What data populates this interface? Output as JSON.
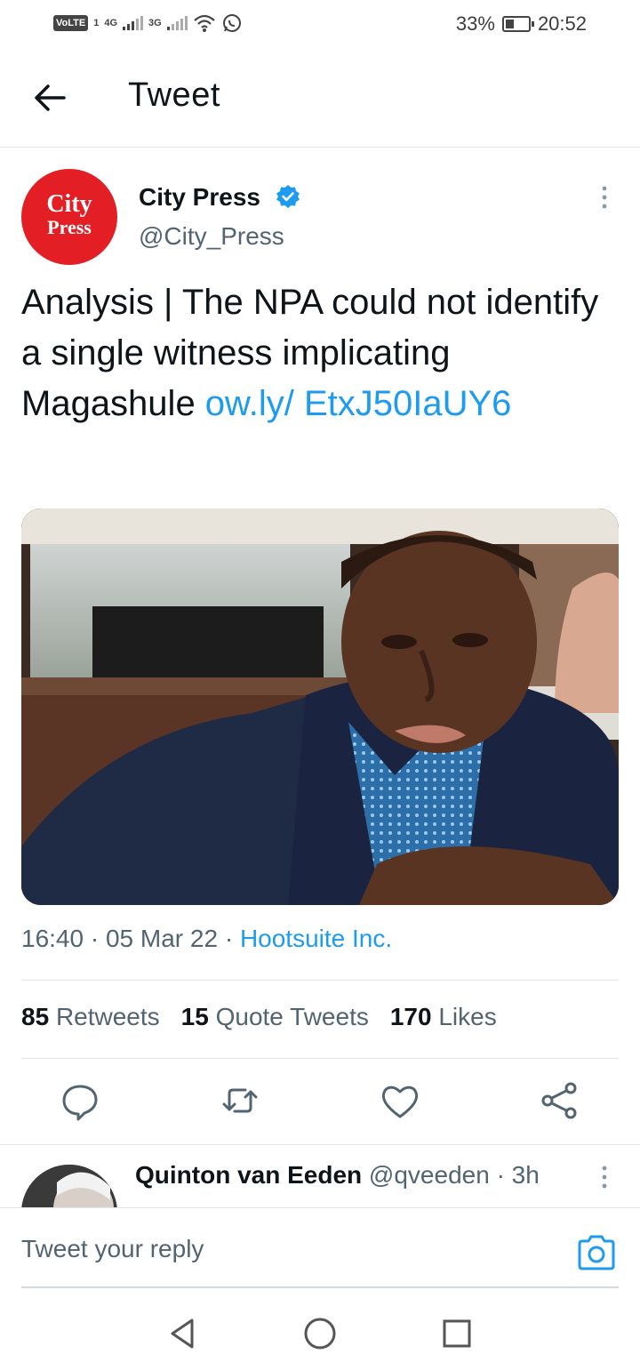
{
  "status_bar": {
    "volte": "VoLTE",
    "sim1": "1",
    "net1": "4G",
    "net2": "3G",
    "battery_percent": "33%",
    "battery_level": 0.33,
    "time": "20:52"
  },
  "header": {
    "title": "Tweet",
    "back_icon": "arrow-left-icon"
  },
  "tweet": {
    "avatar_text_line1": "City",
    "avatar_text_line2": "Press",
    "author_name": "City Press",
    "verified_icon": "verified-badge-icon",
    "handle": "@City_Press",
    "text_main": "Analysis | The NPA could not identify a single witness implicating Magashule ",
    "text_link": "ow.ly/ EtxJ50IaUY6",
    "time": "16:40",
    "date": "05 Mar 22",
    "separator": "·",
    "source": "Hootsuite Inc.",
    "retweets_count": "85",
    "retweets_label": "Retweets",
    "quotes_count": "15",
    "quotes_label": "Quote Tweets",
    "likes_count": "170",
    "likes_label": "Likes"
  },
  "actions": [
    {
      "icon": "reply-icon"
    },
    {
      "icon": "retweet-icon"
    },
    {
      "icon": "like-heart-icon"
    },
    {
      "icon": "share-icon"
    }
  ],
  "reply": {
    "name": "Quinton van Eeden",
    "handle": "@qveeden",
    "separator": "·",
    "time": "3h"
  },
  "reply_bar": {
    "placeholder": "Tweet your reply",
    "camera_icon": "camera-icon"
  },
  "nav_bar": {
    "back_icon": "nav-back-triangle-icon",
    "home_icon": "nav-home-circle-icon",
    "recents_icon": "nav-recents-square-icon"
  },
  "colors": {
    "accent": "#1d9bf0",
    "brand_red": "#e31e24",
    "text": "#0f1419",
    "secondary": "#536471"
  }
}
